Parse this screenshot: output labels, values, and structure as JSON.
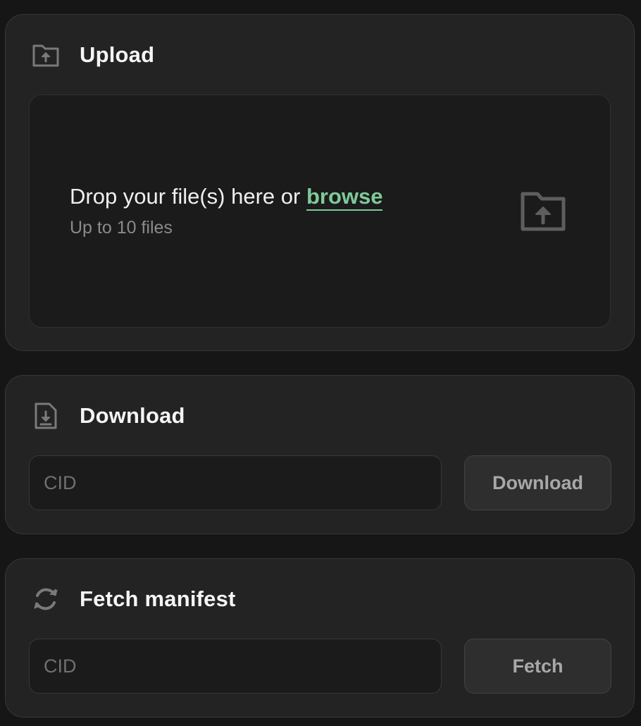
{
  "upload": {
    "icon": "folder-upload-icon",
    "title": "Upload",
    "dropzone": {
      "text": "Drop your file(s) here or ",
      "browse_label": "browse",
      "hint": "Up to 10 files",
      "icon": "folder-upload-icon"
    }
  },
  "download": {
    "icon": "file-download-icon",
    "title": "Download",
    "input_placeholder": "CID",
    "input_value": "",
    "button_label": "Download"
  },
  "fetch": {
    "icon": "refresh-icon",
    "title": "Fetch manifest",
    "input_placeholder": "CID",
    "input_value": "",
    "button_label": "Fetch"
  },
  "colors": {
    "background": "#161616",
    "card": "#232323",
    "accent": "#7fc99a"
  }
}
